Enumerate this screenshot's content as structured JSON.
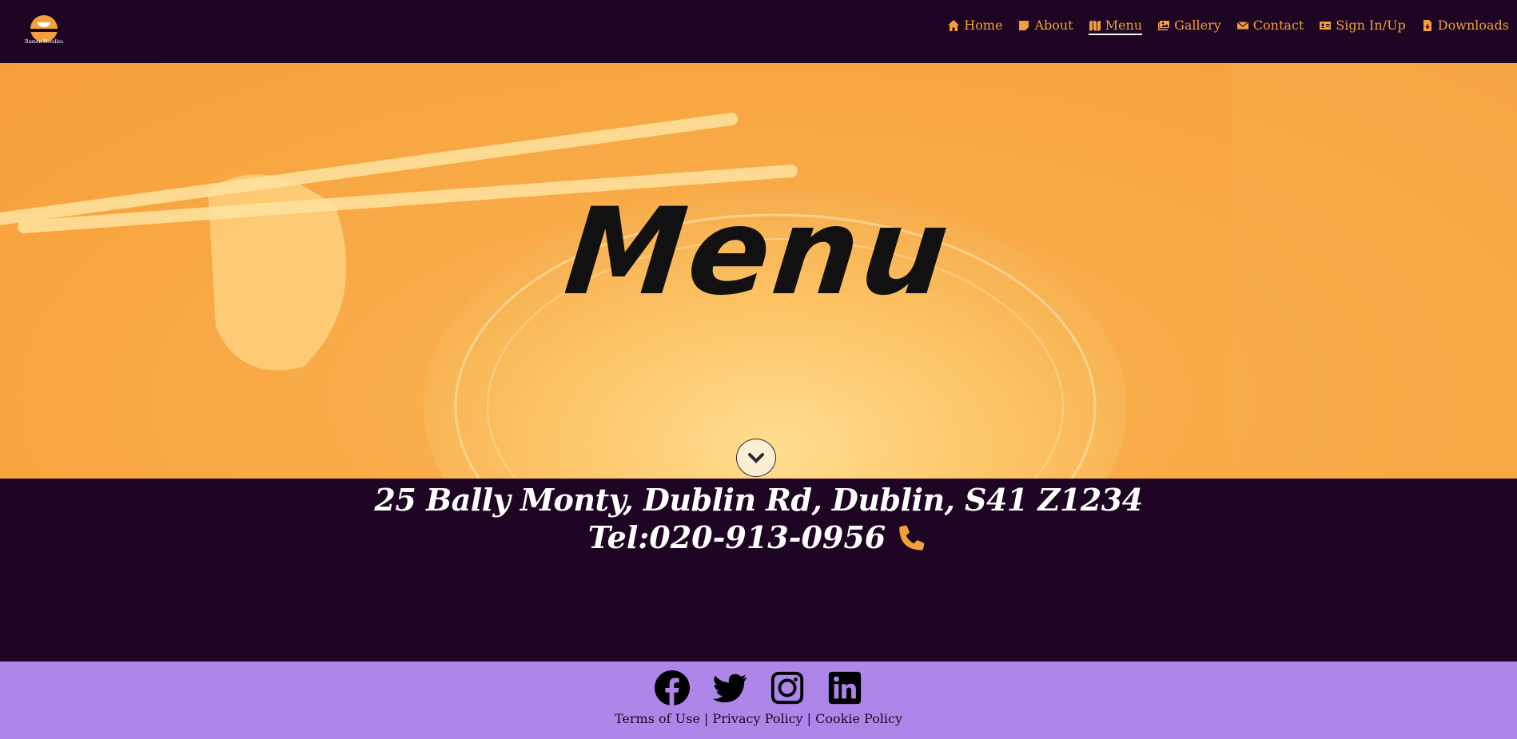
{
  "brand": {
    "logo_text": "Ramen Noodles",
    "colors": {
      "nav_bg": "#1e0523",
      "accent": "#f2a03d",
      "footer_bg": "#ae86e9"
    }
  },
  "nav": {
    "items": [
      {
        "label": "Home",
        "icon": "home-icon",
        "active": false
      },
      {
        "label": "About",
        "icon": "note-icon",
        "active": false
      },
      {
        "label": "Menu",
        "icon": "map-icon",
        "active": true
      },
      {
        "label": "Gallery",
        "icon": "images-icon",
        "active": false
      },
      {
        "label": "Contact",
        "icon": "envelope-icon",
        "active": false
      },
      {
        "label": "Sign In/Up",
        "icon": "id-card-icon",
        "active": false
      },
      {
        "label": "Downloads",
        "icon": "file-download-icon",
        "active": false
      }
    ]
  },
  "hero": {
    "title": "Menu",
    "scroll_icon": "chevron-down-icon"
  },
  "info": {
    "address": "25 Bally Monty, Dublin Rd, Dublin, S41 Z1234",
    "tel": "Tel:020-913-0956",
    "tel_icon": "phone-icon"
  },
  "footer": {
    "socials": [
      "facebook-icon",
      "twitter-icon",
      "instagram-icon",
      "linkedin-icon"
    ],
    "links": [
      "Terms of Use",
      "Privacy Policy",
      "Cookie Policy"
    ],
    "separator": "|"
  }
}
